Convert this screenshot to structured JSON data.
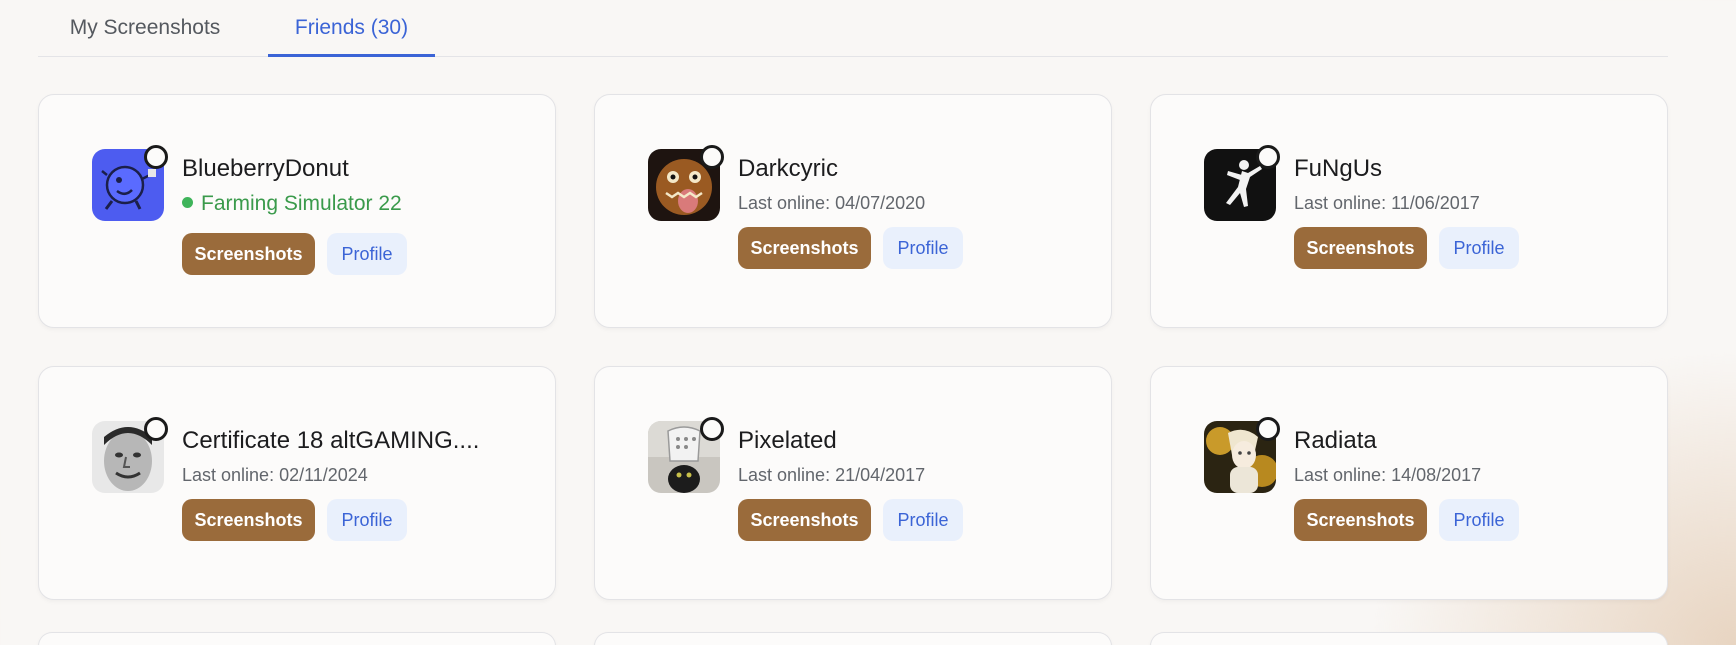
{
  "tabs": {
    "my_screenshots": "My Screenshots",
    "friends": "Friends (30)"
  },
  "buttons": {
    "screenshots": "Screenshots",
    "profile": "Profile"
  },
  "friends": [
    {
      "name": "BlueberryDonut",
      "status": "Farming Simulator 22",
      "playing": true,
      "avatar": "blue-cartoon-avatar"
    },
    {
      "name": "Darkcyric",
      "status": "Last online: 04/07/2020",
      "playing": false,
      "avatar": "monster-avatar"
    },
    {
      "name": "FuNgUs",
      "status": "Last online: 11/06/2017",
      "playing": false,
      "avatar": "jumpman-logo-avatar"
    },
    {
      "name": "Certificate 18 altGAMING....",
      "status": "Last online: 02/11/2024",
      "playing": false,
      "avatar": "face-photo-avatar"
    },
    {
      "name": "Pixelated",
      "status": "Last online: 21/04/2017",
      "playing": false,
      "avatar": "cat-photo-avatar"
    },
    {
      "name": "Radiata",
      "status": "Last online: 14/08/2017",
      "playing": false,
      "avatar": "anime-art-avatar"
    }
  ],
  "colors": {
    "accent": "#3b64d6",
    "screenshots_button": "#9a6b3b",
    "profile_button_bg": "#e9f0fc",
    "online_green": "#3a9a4b"
  }
}
